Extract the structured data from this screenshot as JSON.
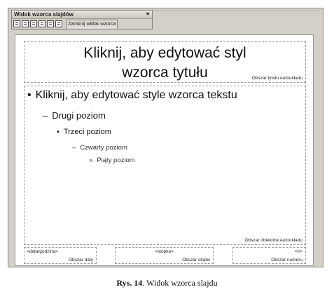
{
  "toolbar": {
    "title": "Widok wzorca slajdów",
    "close_label": "Zamknij widok wzorca",
    "icons": [
      "insert-master-icon",
      "insert-title-master-icon",
      "delete-master-icon",
      "preserve-master-icon",
      "rename-master-icon",
      "master-layout-icon"
    ]
  },
  "slide": {
    "title_line1": "Kliknij, aby edytować styl",
    "title_line2": "wzorca tytułu",
    "title_area_label": "Obszar tytułu Autoukładu",
    "levels": [
      {
        "bullet": "•",
        "text": "Kliknij, aby edytować style wzorca tekstu"
      },
      {
        "bullet": "–",
        "text": "Drugi poziom"
      },
      {
        "bullet": "•",
        "text": "Trzeci poziom"
      },
      {
        "bullet": "–",
        "text": "Czwarty poziom"
      },
      {
        "bullet": "»",
        "text": "Piąty poziom"
      }
    ],
    "body_area_label": "Obszar obiektów Autoukładu",
    "date_value": "<data/godzina>",
    "date_label": "Obszar daty",
    "footer_value": "<stopka>",
    "footer_label": "Obszar stopki",
    "number_value": "<#>",
    "number_label": "Obszar numeru"
  },
  "caption": {
    "prefix": "Rys. 14",
    "text": ". Widok wzorca slajdu"
  }
}
